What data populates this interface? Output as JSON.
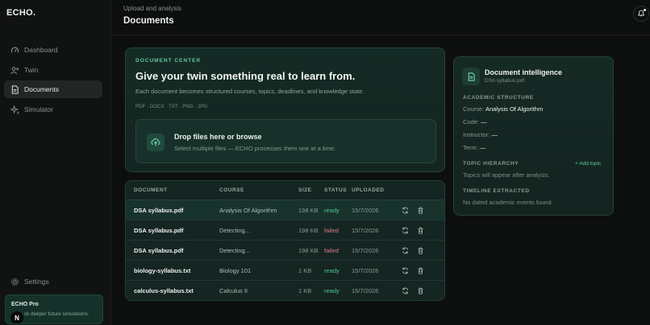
{
  "app": {
    "logo": "ECHO."
  },
  "sidebar": {
    "items": [
      {
        "label": "Dashboard",
        "icon": "gauge-icon"
      },
      {
        "label": "Twin",
        "icon": "twin-icon"
      },
      {
        "label": "Documents",
        "icon": "document-icon",
        "active": true
      },
      {
        "label": "Simulator",
        "icon": "sparkle-icon"
      }
    ],
    "settings_label": "Settings",
    "pro": {
      "title": "ECHO Pro",
      "subtitle": "ck deeper future simulations.",
      "avatar": "N"
    }
  },
  "header": {
    "breadcrumb": "Upload and analysis",
    "title": "Documents"
  },
  "upload": {
    "eyebrow": "DOCUMENT CENTER",
    "title": "Give your twin something real to learn from.",
    "description": "Each document becomes structured courses, topics, deadlines, and knowledge state.",
    "types": "PDF · DOCX · TXT · PNG · JPG",
    "drop_title": "Drop files here or browse",
    "drop_subtitle": "Select multiple files — ECHO processes them one at a time."
  },
  "table": {
    "headers": {
      "document": "DOCUMENT",
      "course": "COURSE",
      "size": "SIZE",
      "status": "STATUS",
      "uploaded": "UPLOADED"
    },
    "rows": [
      {
        "document": "DSA syllabus.pdf",
        "course": "Analysis Of Algorithm",
        "size": "198 KB",
        "status": "ready",
        "uploaded": "15/7/2026"
      },
      {
        "document": "DSA syllabus.pdf",
        "course": "Detecting...",
        "size": "198 KB",
        "status": "failed",
        "uploaded": "15/7/2026"
      },
      {
        "document": "DSA syllabus.pdf",
        "course": "Detecting...",
        "size": "198 KB",
        "status": "failed",
        "uploaded": "15/7/2026"
      },
      {
        "document": "biology-syllabus.txt",
        "course": "Biology 101",
        "size": "1 KB",
        "status": "ready",
        "uploaded": "15/7/2026"
      },
      {
        "document": "calculus-syllabus.txt",
        "course": "Calculus II",
        "size": "1 KB",
        "status": "ready",
        "uploaded": "15/7/2026"
      }
    ]
  },
  "intel": {
    "title": "Document intelligence",
    "subtitle": "DSA syllabus.pdf",
    "academic_heading": "ACADEMIC STRUCTURE",
    "course_label": "Course:",
    "course_value": "Analysis Of Algorithm",
    "code_label": "Code:",
    "code_value": "—",
    "instructor_label": "Instructor:",
    "instructor_value": "—",
    "term_label": "Term:",
    "term_value": "—",
    "topic_heading": "TOPIC HIERARCHY",
    "add_topic": "+ Add topic",
    "topic_empty": "Topics will appear after analysis.",
    "timeline_heading": "TIMELINE EXTRACTED",
    "timeline_empty": "No dated academic events found."
  },
  "colors": {
    "accent": "#5ec9a0",
    "ready": "#4fc98e",
    "failed": "#e07a8a",
    "background": "#0d0f0e"
  }
}
